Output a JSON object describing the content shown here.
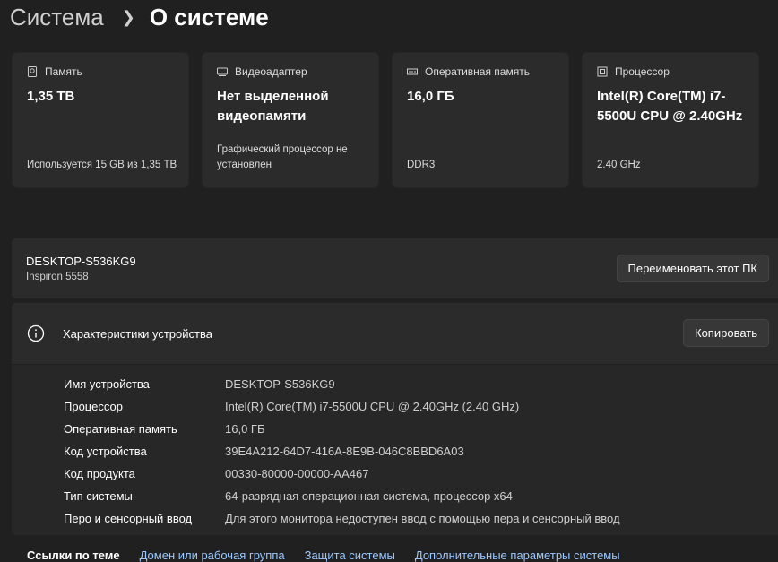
{
  "breadcrumb": {
    "parent": "Система",
    "current": "О системе"
  },
  "cards": [
    {
      "icon": "hard-drive-icon",
      "title": "Память",
      "value": "1,35 TB",
      "sub": "Используется 15 GB из 1,35 TB"
    },
    {
      "icon": "display-adapter-icon",
      "title": "Видеоадаптер",
      "value": "Нет выделенной видеопамяти",
      "sub": "Графический процессор не установлен"
    },
    {
      "icon": "ram-icon",
      "title": "Оперативная память",
      "value": "16,0 ГБ",
      "sub": "DDR3"
    },
    {
      "icon": "processor-icon",
      "title": "Процессор",
      "value": "Intel(R) Core(TM) i7-5500U CPU @ 2.40GHz",
      "sub": "2.40 GHz"
    }
  ],
  "device": {
    "name": "DESKTOP-S536KG9",
    "model": "Inspiron 5558",
    "rename_button": "Переименовать этот ПК"
  },
  "specs": {
    "title": "Характеристики устройства",
    "copy_button": "Копировать",
    "rows": [
      {
        "k": "Имя устройства",
        "v": "DESKTOP-S536KG9"
      },
      {
        "k": "Процессор",
        "v": "Intel(R) Core(TM) i7-5500U CPU @ 2.40GHz (2.40 GHz)"
      },
      {
        "k": "Оперативная память",
        "v": "16,0 ГБ"
      },
      {
        "k": "Код устройства",
        "v": "39E4A212-64D7-416A-8E9B-046C8BBD6A03"
      },
      {
        "k": "Код продукта",
        "v": "00330-80000-00000-AA467"
      },
      {
        "k": "Тип системы",
        "v": "64-разрядная операционная система, процессор x64"
      },
      {
        "k": "Перо и сенсорный ввод",
        "v": "Для этого монитора недоступен ввод с помощью пера и сенсорный ввод"
      }
    ]
  },
  "related": {
    "label": "Ссылки по теме",
    "links": [
      "Домен или рабочая группа",
      "Защита системы",
      "Дополнительные параметры системы"
    ]
  }
}
